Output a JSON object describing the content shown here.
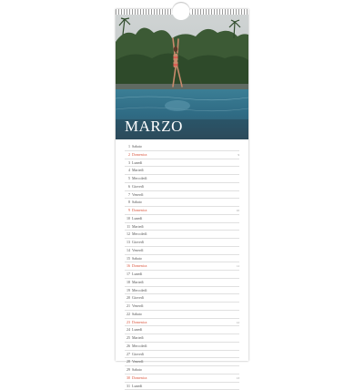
{
  "calendar": {
    "month": "MARZO",
    "days": [
      {
        "num": "1",
        "name": "Sabato",
        "sunday": false
      },
      {
        "num": "2",
        "name": "Domenica",
        "sunday": true
      },
      {
        "num": "3",
        "name": "Lunedì",
        "sunday": false
      },
      {
        "num": "4",
        "name": "Martedì",
        "sunday": false
      },
      {
        "num": "5",
        "name": "Mercoledì",
        "sunday": false
      },
      {
        "num": "6",
        "name": "Giovedì",
        "sunday": false
      },
      {
        "num": "7",
        "name": "Venerdì",
        "sunday": false
      },
      {
        "num": "8",
        "name": "Sabato",
        "sunday": false
      },
      {
        "num": "9",
        "name": "Domenica",
        "sunday": true
      },
      {
        "num": "10",
        "name": "Lunedì",
        "sunday": false
      },
      {
        "num": "11",
        "name": "Martedì",
        "sunday": false
      },
      {
        "num": "12",
        "name": "Mercoledì",
        "sunday": false
      },
      {
        "num": "13",
        "name": "Giovedì",
        "sunday": false
      },
      {
        "num": "14",
        "name": "Venerdì",
        "sunday": false
      },
      {
        "num": "15",
        "name": "Sabato",
        "sunday": false
      },
      {
        "num": "16",
        "name": "Domenica",
        "sunday": true
      },
      {
        "num": "17",
        "name": "Lunedì",
        "sunday": false
      },
      {
        "num": "18",
        "name": "Martedì",
        "sunday": false
      },
      {
        "num": "19",
        "name": "Mercoledì",
        "sunday": false
      },
      {
        "num": "20",
        "name": "Giovedì",
        "sunday": false
      },
      {
        "num": "21",
        "name": "Venerdì",
        "sunday": false
      },
      {
        "num": "22",
        "name": "Sabato",
        "sunday": false
      },
      {
        "num": "23",
        "name": "Domenica",
        "sunday": true
      },
      {
        "num": "24",
        "name": "Lunedì",
        "sunday": false
      },
      {
        "num": "25",
        "name": "Martedì",
        "sunday": false
      },
      {
        "num": "26",
        "name": "Mercoledì",
        "sunday": false
      },
      {
        "num": "27",
        "name": "Giovedì",
        "sunday": false
      },
      {
        "num": "28",
        "name": "Venerdì",
        "sunday": false
      },
      {
        "num": "29",
        "name": "Sabato",
        "sunday": false
      },
      {
        "num": "30",
        "name": "Domenica",
        "sunday": true
      },
      {
        "num": "31",
        "name": "Lunedì",
        "sunday": false
      }
    ],
    "week_marks": [
      "9",
      "10",
      "11",
      "12",
      "13"
    ]
  },
  "colors": {
    "sunday": "#d9533b",
    "text": "#555555"
  }
}
